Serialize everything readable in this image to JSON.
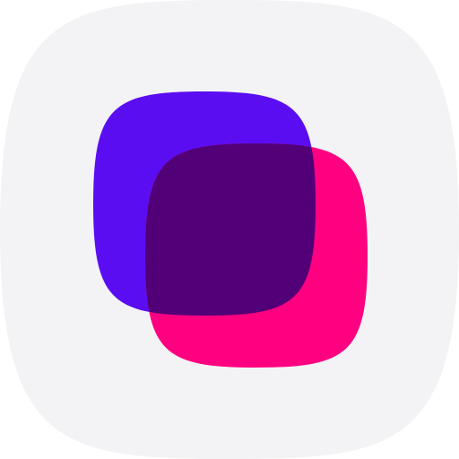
{
  "app_icon": {
    "icon_name": "overlapping-squares-icon",
    "colors": {
      "background_tile": "#f3f3f5",
      "back_square": "#5b0df2",
      "front_square": "#ff0080",
      "overlap": "#520078"
    }
  }
}
